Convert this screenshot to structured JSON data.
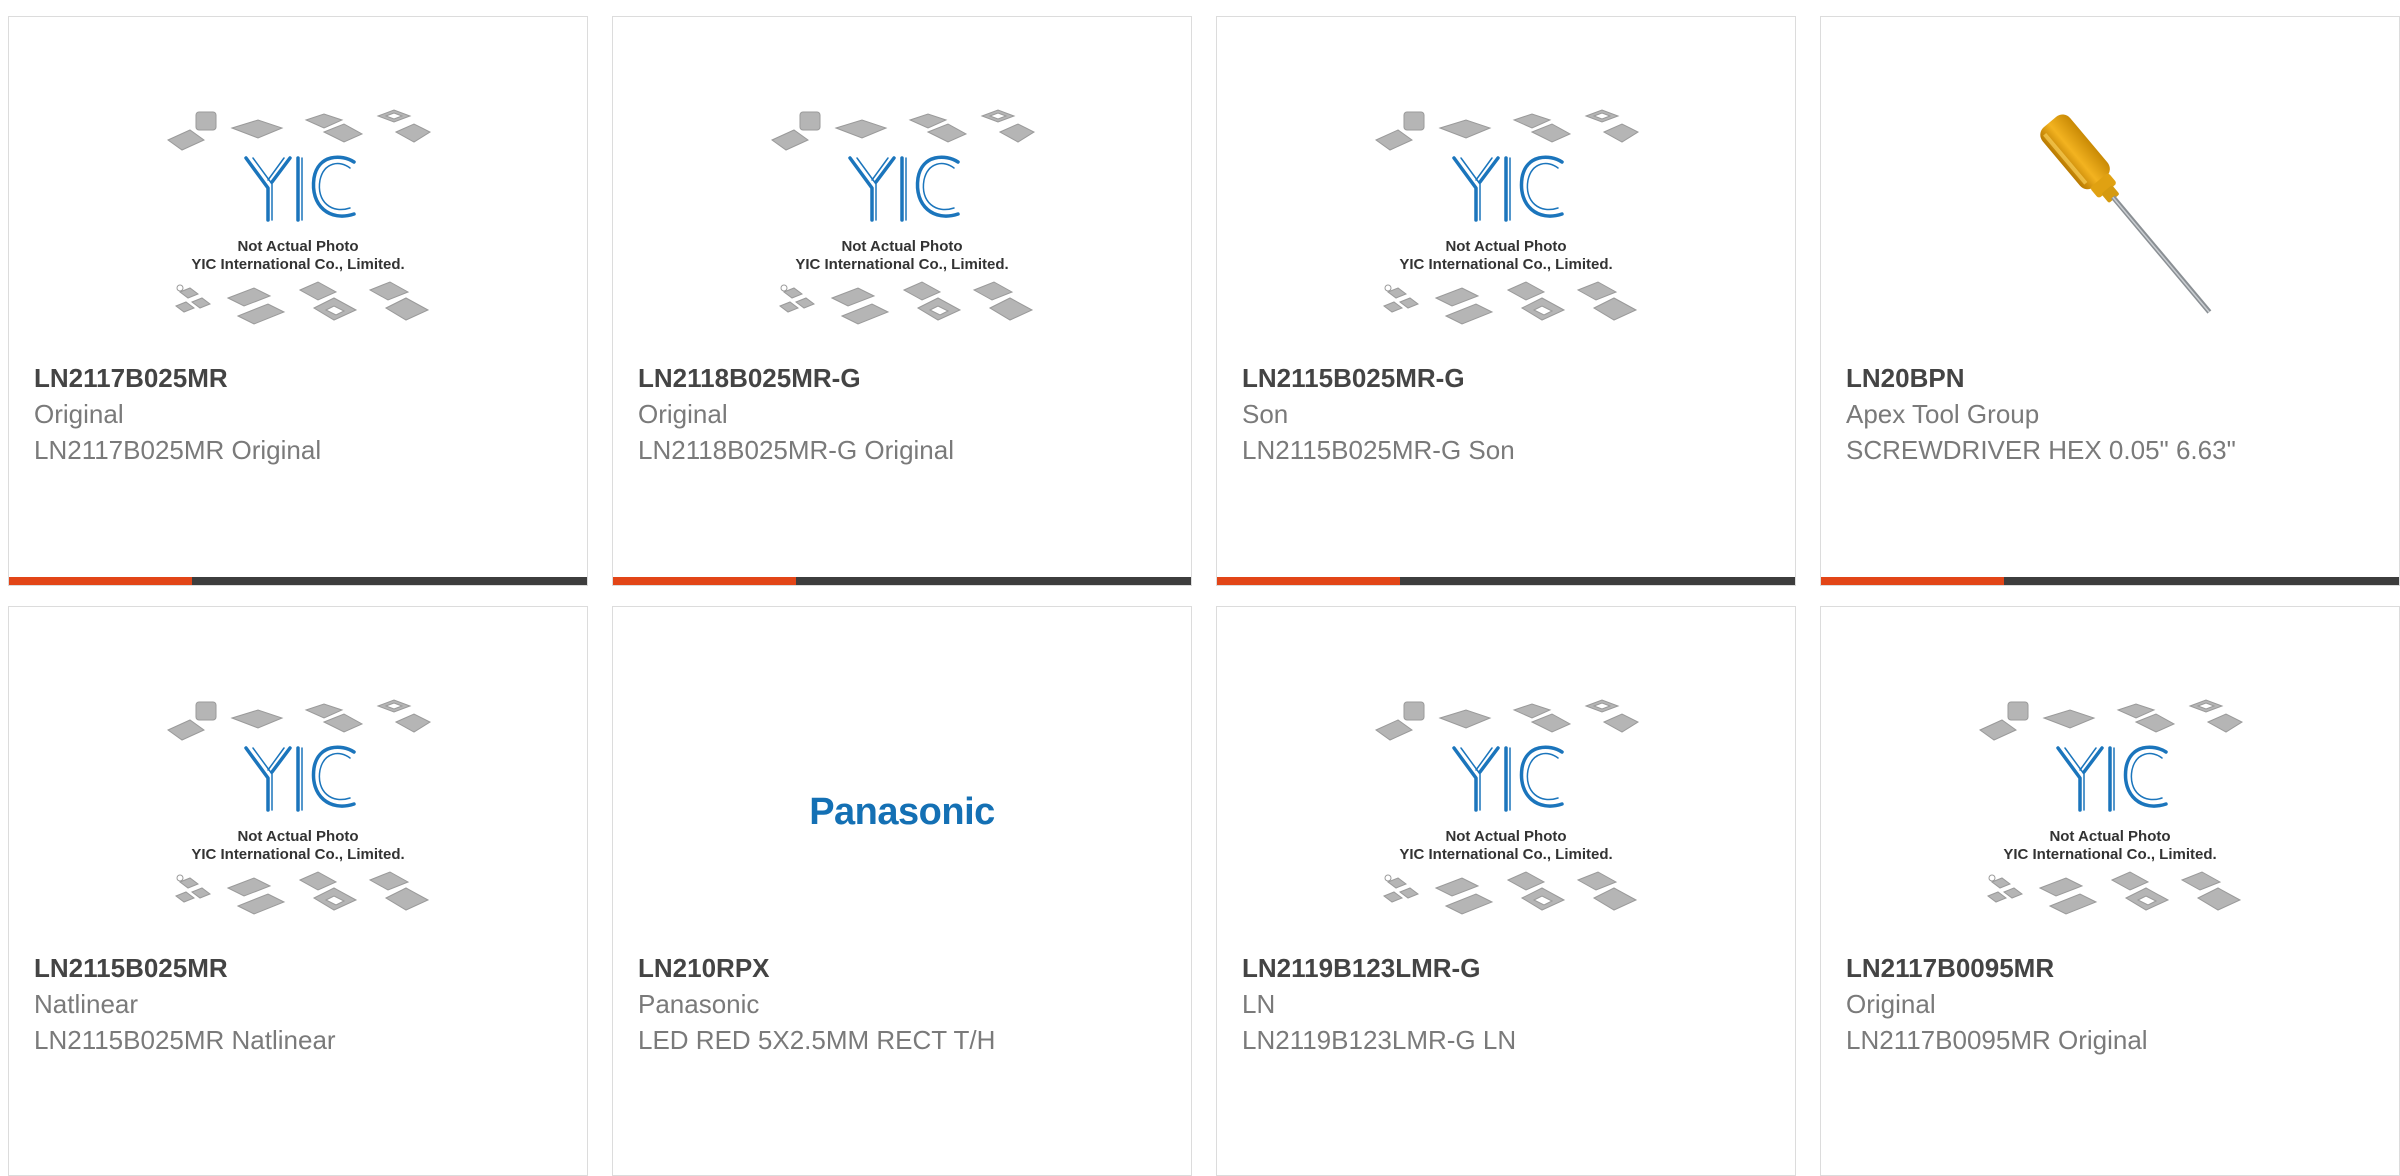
{
  "placeholder_image": {
    "line1": "Not Actual Photo",
    "line2": "YIC International Co., Limited.",
    "logo": "YIC"
  },
  "products": [
    {
      "part_number": "LN2117B025MR",
      "manufacturer": "Original",
      "description": "LN2117B025MR Original",
      "image": "yic-placeholder"
    },
    {
      "part_number": "LN2118B025MR-G",
      "manufacturer": "Original",
      "description": "LN2118B025MR-G Original",
      "image": "yic-placeholder"
    },
    {
      "part_number": "LN2115B025MR-G",
      "manufacturer": "Son",
      "description": "LN2115B025MR-G Son",
      "image": "yic-placeholder"
    },
    {
      "part_number": "LN20BPN",
      "manufacturer": "Apex Tool Group",
      "description": "SCREWDRIVER HEX 0.05\" 6.63\"",
      "image": "screwdriver"
    },
    {
      "part_number": "LN2115B025MR",
      "manufacturer": "Natlinear",
      "description": "LN2115B025MR Natlinear",
      "image": "yic-placeholder"
    },
    {
      "part_number": "LN210RPX",
      "manufacturer": "Panasonic",
      "description": "LED RED 5X2.5MM RECT T/H",
      "image": "panasonic-logo",
      "brand_text": "Panasonic"
    },
    {
      "part_number": "LN2119B123LMR-G",
      "manufacturer": "LN",
      "description": "LN2119B123LMR-G LN",
      "image": "yic-placeholder"
    },
    {
      "part_number": "LN2117B0095MR",
      "manufacturer": "Original",
      "description": "LN2117B0095MR Original",
      "image": "yic-placeholder"
    }
  ],
  "colors": {
    "accent": "#e24517",
    "bar": "#3d3d3d",
    "logo_blue": "#1b75bc",
    "panasonic_blue": "#1470b4"
  }
}
